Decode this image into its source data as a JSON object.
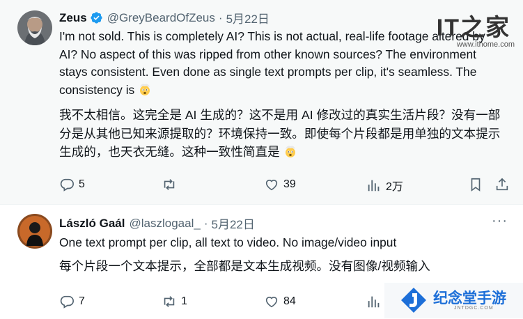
{
  "tweet1": {
    "name": "Zeus",
    "handle": "@GreyBeardOfZeus",
    "date": "5月22日",
    "text_en": "I'm not sold. This is completely AI? This is not actual, real-life footage altered by AI? No aspect of this was ripped from other known sources? The environment stays consistent. Even done as single text prompts per clip, it's seamless. The consistency is",
    "text_zh": "我不太相信。这完全是 AI 生成的？这不是用 AI 修改过的真实生活片段？没有一部分是从其他已知来源提取的？环境保持一致。即使每个片段都是用单独的文本提示生成的，也天衣无缝。这种一致性简直是",
    "reply_count": "5",
    "retweet_count": "",
    "like_count": "39",
    "views_count": "2万"
  },
  "tweet2": {
    "name": "László Gaál",
    "handle": "@laszlogaal_",
    "date": "5月22日",
    "text_en": "One text prompt per clip, all text to video. No image/video input",
    "text_zh": "每个片段一个文本提示，全部都是文本生成视频。没有图像/视频输入",
    "reply_count": "7",
    "retweet_count": "1",
    "like_count": "84"
  },
  "watermark_top": {
    "logo": "IT之家",
    "url": "www.ithome.com"
  },
  "watermark_bottom": {
    "logo_text": "纪念堂手游",
    "sub": "JNTDGC.COM"
  },
  "colors": {
    "verified": "#1d9bf0",
    "secondary": "#536471",
    "primary_text": "#0f1419"
  },
  "icons": [
    "verified-badge-icon",
    "reply-icon",
    "retweet-icon",
    "like-icon",
    "views-icon",
    "bookmark-icon",
    "share-icon",
    "more-icon",
    "exploding-head-emoji"
  ]
}
